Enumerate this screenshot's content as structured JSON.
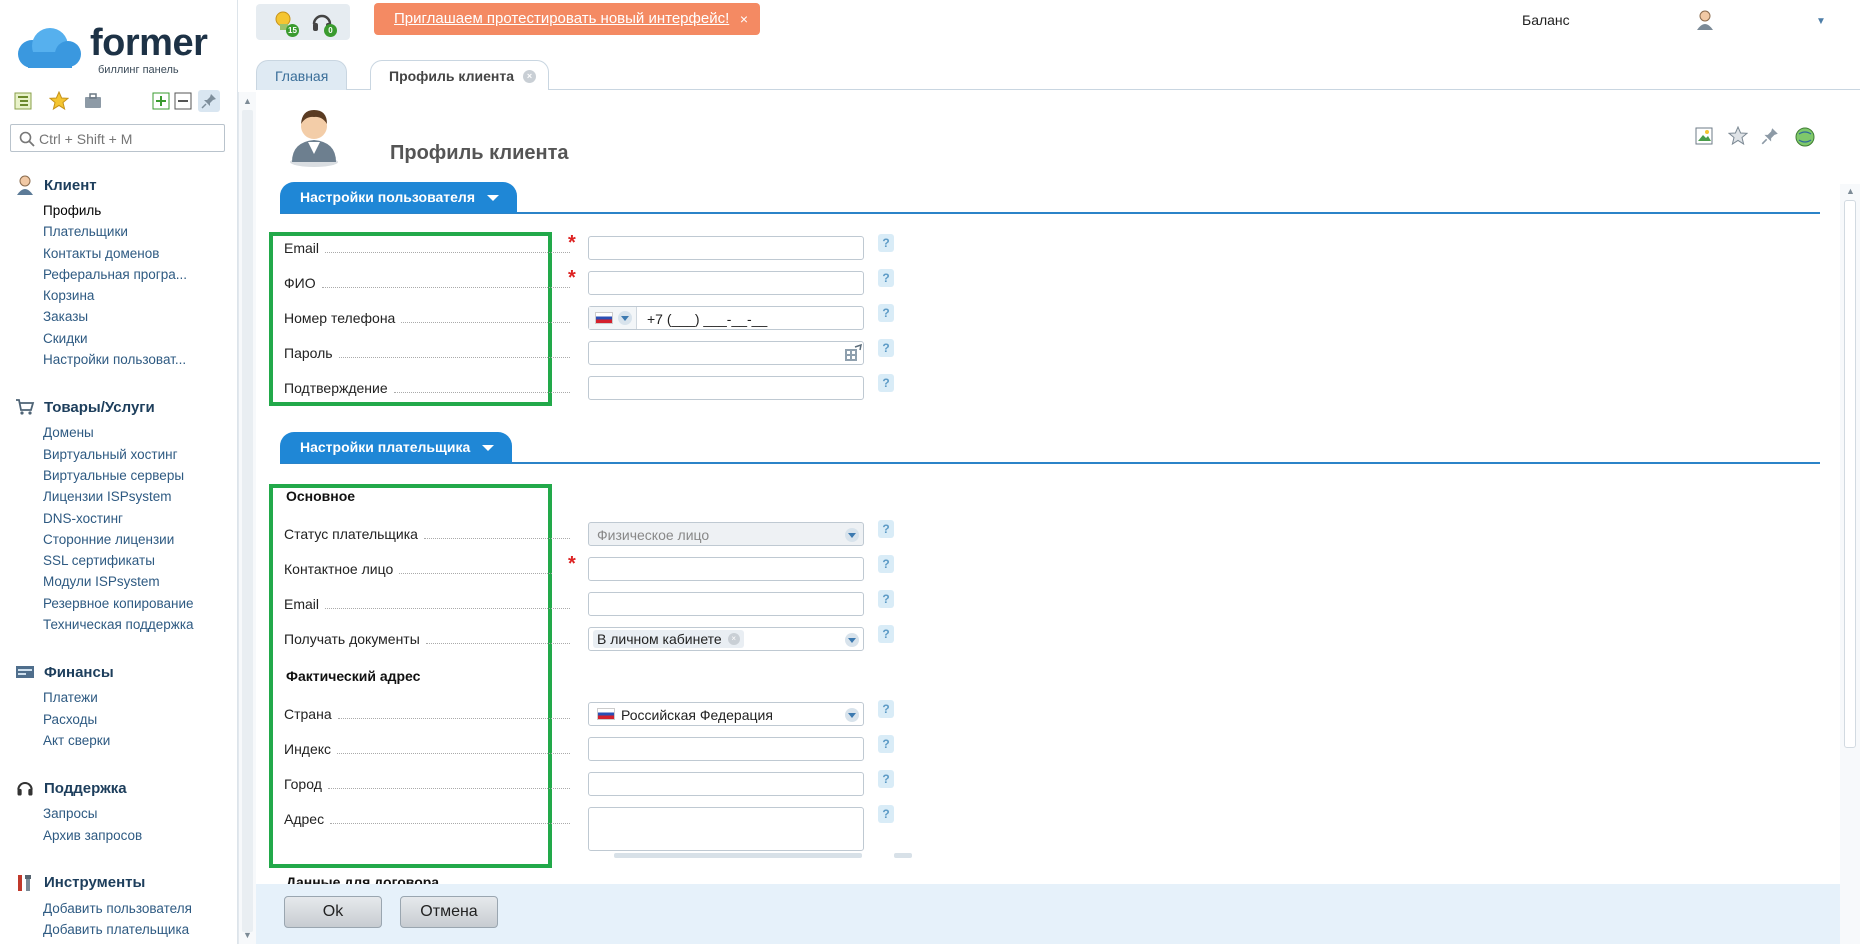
{
  "logo": {
    "text": "former",
    "subtitle": "биллинг панель"
  },
  "sidebar": {
    "search_placeholder": "Ctrl + Shift + M",
    "groups": [
      {
        "title": "Клиент",
        "icon": "client-icon",
        "items": [
          "Профиль",
          "Плательщики",
          "Контакты доменов",
          "Реферальная програ...",
          "Корзина",
          "Заказы",
          "Скидки",
          "Настройки пользоват..."
        ]
      },
      {
        "title": "Товары/Услуги",
        "icon": "cart-icon",
        "items": [
          "Домены",
          "Виртуальный хостинг",
          "Виртуальные серверы",
          "Лицензии ISPsystem",
          "DNS-хостинг",
          "Сторонние лицензии",
          "SSL сертификаты",
          "Модули ISPsystem",
          "Резервное копирование",
          "Техническая поддержка"
        ]
      },
      {
        "title": "Финансы",
        "icon": "finance-icon",
        "items": [
          "Платежи",
          "Расходы",
          "Акт сверки"
        ]
      },
      {
        "title": "Поддержка",
        "icon": "headset-icon",
        "items": [
          "Запросы",
          "Архив запросов"
        ]
      },
      {
        "title": "Инструменты",
        "icon": "tools-icon",
        "items": [
          "Добавить пользователя",
          "Добавить плательщика"
        ]
      }
    ]
  },
  "topbar": {
    "notif_count": "15",
    "support_count": "0",
    "promo_text": "Приглашаем протестировать новый интерфейс!",
    "promo_close": "×",
    "balance_label": "Баланс"
  },
  "tabs": {
    "home": "Главная",
    "profile": "Профиль клиента",
    "close": "×"
  },
  "page": {
    "title": "Профиль клиента"
  },
  "sections": {
    "user": {
      "title": "Настройки пользователя",
      "fields": {
        "email": {
          "label": "Email",
          "value": ""
        },
        "fio": {
          "label": "ФИО",
          "value": ""
        },
        "phone": {
          "label": "Номер телефона",
          "value": "+7 (___) ___-__-__"
        },
        "password": {
          "label": "Пароль",
          "value": ""
        },
        "confirm": {
          "label": "Подтверждение",
          "value": ""
        }
      }
    },
    "payer": {
      "title": "Настройки плательщика",
      "basic_head": "Основное",
      "address_head": "Фактический адрес",
      "contract_head": "Данные для договора",
      "fields": {
        "status": {
          "label": "Статус плательщика",
          "value": "Физическое лицо"
        },
        "contact": {
          "label": "Контактное лицо",
          "value": ""
        },
        "email": {
          "label": "Email",
          "value": ""
        },
        "docs": {
          "label": "Получать документы",
          "value": "В личном кабинете"
        },
        "country": {
          "label": "Страна",
          "value": "Российская Федерация"
        },
        "index": {
          "label": "Индекс",
          "value": ""
        },
        "city": {
          "label": "Город",
          "value": ""
        },
        "address": {
          "label": "Адрес",
          "value": ""
        }
      }
    }
  },
  "help_glyph": "?",
  "required_mark": "*",
  "footer": {
    "ok": "Ok",
    "cancel": "Отмена"
  },
  "colors": {
    "accent": "#1f87d6",
    "highlight": "#22a94a",
    "promo": "#f48a63"
  }
}
